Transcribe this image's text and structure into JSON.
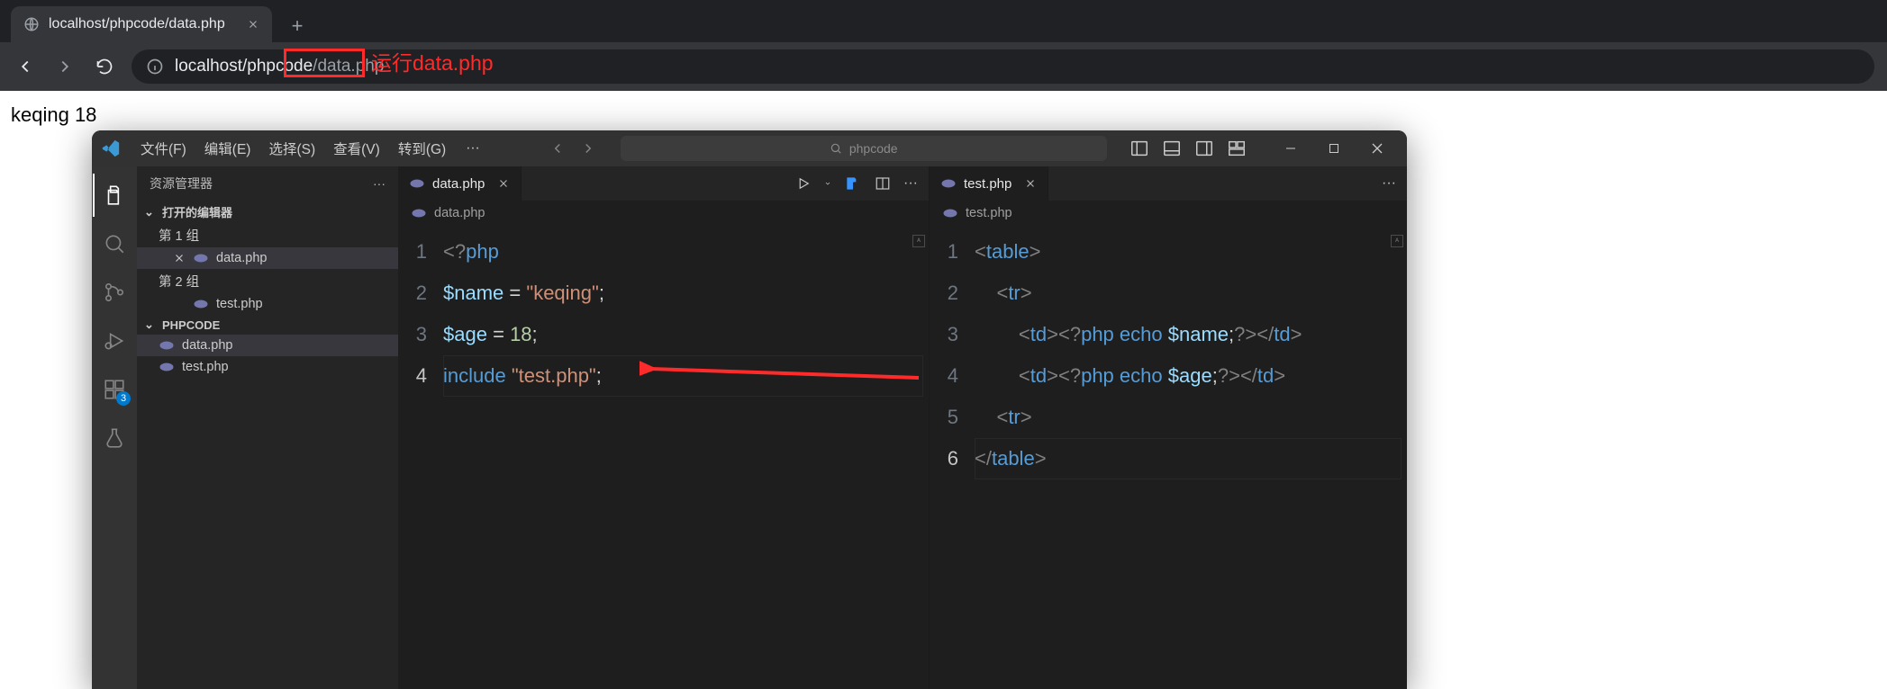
{
  "browser": {
    "tab": {
      "title": "localhost/phpcode/data.php"
    },
    "url_prefix": "localhost/phpcode",
    "url_file": "/data.php",
    "annotation": "运行data.php",
    "page_output": "keqing 18"
  },
  "vscode": {
    "menus": [
      "文件(F)",
      "编辑(E)",
      "选择(S)",
      "查看(V)",
      "转到(G)"
    ],
    "search_placeholder": "phpcode",
    "activity_badge": "3",
    "sidebar": {
      "title": "资源管理器",
      "open_editors": "打开的编辑器",
      "group1": "第 1 组",
      "group2": "第 2 组",
      "project": "PHPCODE",
      "file1": "data.php",
      "file2": "test.php"
    },
    "group1": {
      "tab": "data.php",
      "crumb": "data.php",
      "lines": [
        {
          "n": "1",
          "html": "<span class='tok-tag'>&lt;?</span><span class='tok-kw'>php</span>"
        },
        {
          "n": "2",
          "html": "<span class='tok-var'>$name</span> <span class='tok-op'>=</span> <span class='tok-str'>\"keqing\"</span><span class='tok-punc'>;</span>"
        },
        {
          "n": "3",
          "html": "<span class='tok-var'>$age</span> <span class='tok-op'>=</span> <span class='tok-num'>18</span><span class='tok-punc'>;</span>"
        },
        {
          "n": "4",
          "html": "<span class='tok-fn'>include</span> <span class='tok-str'>\"test.php\"</span><span class='tok-punc'>;</span>"
        }
      ],
      "current_line_index": 3
    },
    "group2": {
      "tab": "test.php",
      "crumb": "test.php",
      "lines": [
        {
          "n": "1",
          "html": "<span class='tok-ang'>&lt;</span><span class='tok-html'>table</span><span class='tok-ang'>&gt;</span>"
        },
        {
          "n": "2",
          "html": "    <span class='tok-ang'>&lt;</span><span class='tok-html'>tr</span><span class='tok-ang'>&gt;</span>"
        },
        {
          "n": "3",
          "html": "        <span class='tok-ang'>&lt;</span><span class='tok-html'>td</span><span class='tok-ang'>&gt;</span><span class='tok-tag'>&lt;?</span><span class='tok-kw'>php</span> <span class='tok-fn'>echo</span> <span class='tok-var'>$name</span><span class='tok-punc'>;</span><span class='tok-tag'>?&gt;</span><span class='tok-ang'>&lt;/</span><span class='tok-html'>td</span><span class='tok-ang'>&gt;</span>"
        },
        {
          "n": "4",
          "html": "        <span class='tok-ang'>&lt;</span><span class='tok-html'>td</span><span class='tok-ang'>&gt;</span><span class='tok-tag'>&lt;?</span><span class='tok-kw'>php</span> <span class='tok-fn'>echo</span> <span class='tok-var'>$age</span><span class='tok-punc'>;</span><span class='tok-tag'>?&gt;</span><span class='tok-ang'>&lt;/</span><span class='tok-html'>td</span><span class='tok-ang'>&gt;</span>"
        },
        {
          "n": "5",
          "html": "    <span class='tok-ang'>&lt;</span><span class='tok-html'>tr</span><span class='tok-ang'>&gt;</span>"
        },
        {
          "n": "6",
          "html": "<span class='tok-ang'>&lt;/</span><span class='tok-html'>table</span><span class='tok-ang'>&gt;</span>"
        }
      ],
      "current_line_index": 5
    }
  }
}
